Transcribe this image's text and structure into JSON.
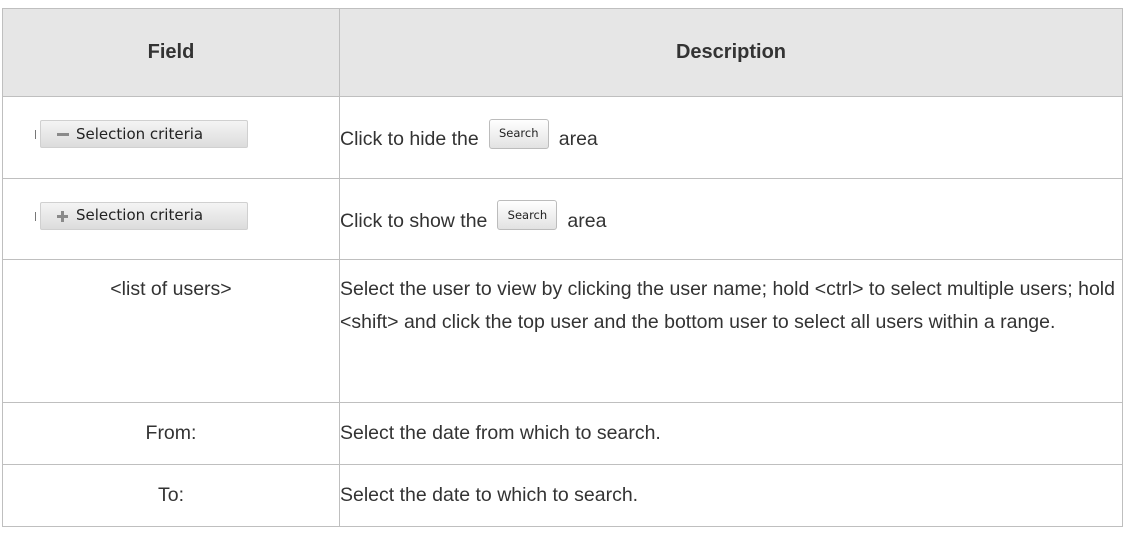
{
  "table": {
    "headers": {
      "field": "Field",
      "description": "Description"
    },
    "rows": [
      {
        "field_widget": {
          "icon": "minus-icon",
          "label": "Selection criteria"
        },
        "description_before": "Click to hide the",
        "description_button": "Search",
        "description_after": "area"
      },
      {
        "field_widget": {
          "icon": "plus-icon",
          "label": "Selection criteria"
        },
        "description_before": "Click to show the",
        "description_button": "Search",
        "description_after": "area"
      },
      {
        "field": "<list of users>",
        "description": "Select the user to view by clicking the user name; hold <ctrl> to select multiple users; hold <shift> and click the top user and the bottom user to select all users within a range."
      },
      {
        "field": "From:",
        "description": "Select the date from which to search."
      },
      {
        "field": "To:",
        "description": "Select the date to which to search."
      }
    ]
  }
}
